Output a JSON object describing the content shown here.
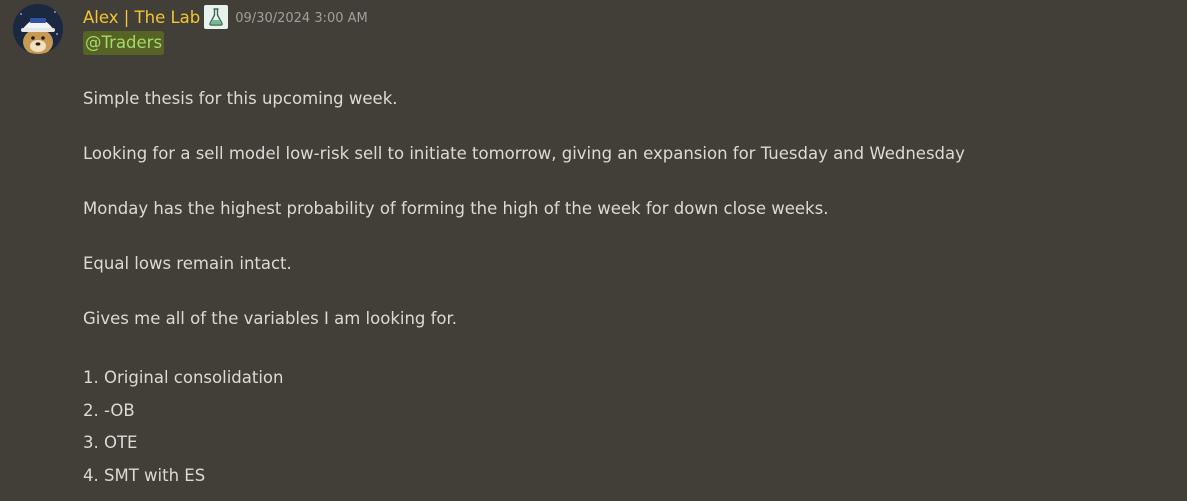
{
  "message": {
    "author": "Alex | The Lab",
    "timestamp": "09/30/2024 3:00 AM",
    "mention": "@Traders",
    "paragraphs": [
      "Simple thesis for this upcoming week.",
      "Looking for a sell model low-risk sell to initiate tomorrow, giving an expansion for Tuesday and Wednesday",
      "Monday has the highest probability of forming the high of the week for down close weeks.",
      "Equal lows remain intact.",
      "Gives me all of the variables I am looking for."
    ],
    "list": [
      "1. Original consolidation",
      "2. -OB",
      "3. OTE",
      "4. SMT with ES"
    ]
  },
  "icons": {
    "avatar": "avatar-image",
    "role": "flask-icon"
  },
  "colors": {
    "background": "#423f38",
    "username": "#f2c531",
    "mention_text": "#a6d96a",
    "mention_bg": "#566324",
    "body_text": "#dcdad3",
    "timestamp": "#a09f99"
  }
}
